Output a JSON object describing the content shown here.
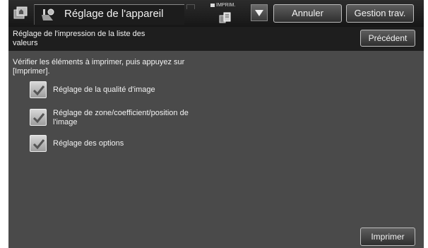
{
  "topbar": {
    "title": "Réglage de l'appareil",
    "job_label": "IMPRIM.",
    "cancel_label": "Annuler",
    "job_status_label": "Gestion trav."
  },
  "header": {
    "title": "Réglage de l'impression de la liste des valeurs",
    "back_label": "Précédent"
  },
  "main": {
    "instruction": "Vérifier les éléments à imprimer, puis appuyez sur [Imprimer].",
    "items": [
      {
        "label": "Réglage de la qualité d'image",
        "checked": true
      },
      {
        "label": "Réglage de zone/coefficient/position de l'image",
        "checked": true
      },
      {
        "label": "Réglage des options",
        "checked": true
      }
    ],
    "print_label": "Imprimer"
  },
  "icons": {
    "home": "home-icon",
    "settings": "settings-icon",
    "job": "job-icon",
    "dropdown": "chevron-down-icon",
    "check": "check-icon"
  },
  "colors": {
    "background": "#4a4a4a",
    "bar": "#1e1e1e",
    "text": "#f2f2f2"
  }
}
